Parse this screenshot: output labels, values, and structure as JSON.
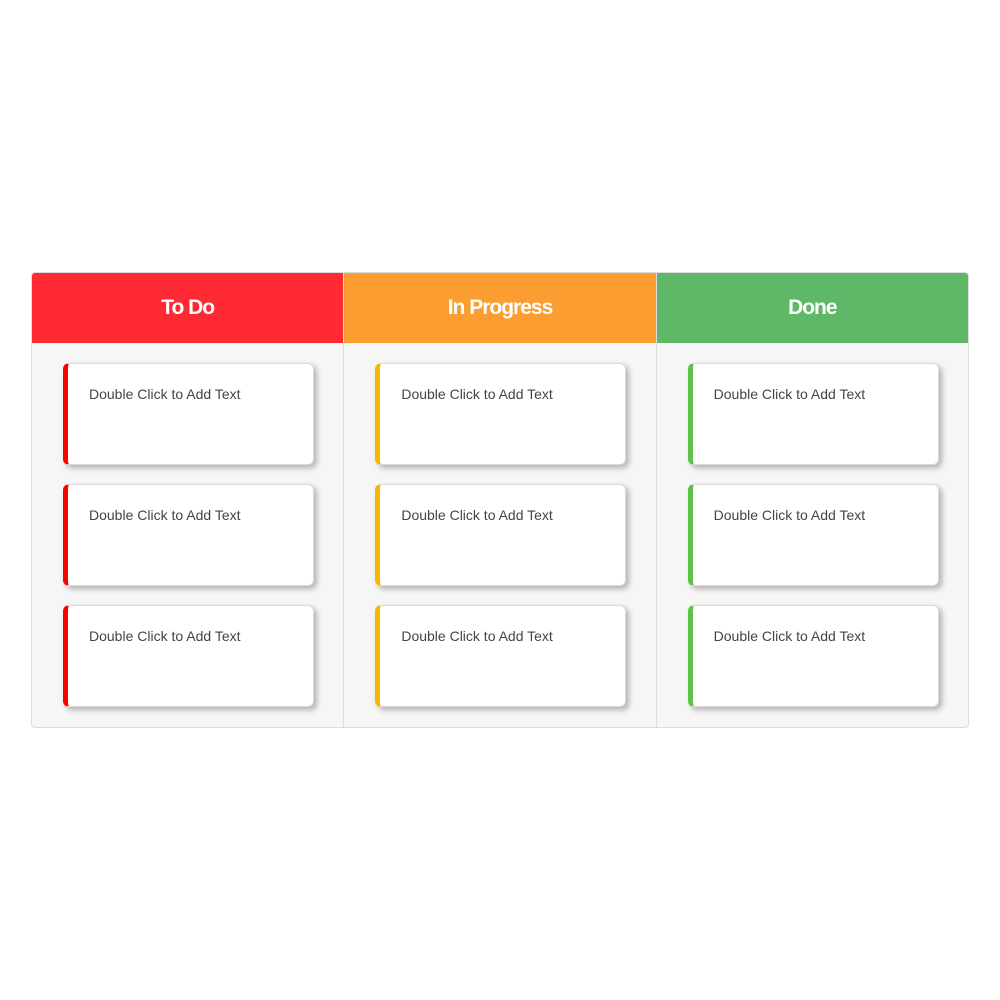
{
  "columns": [
    {
      "title": "To Do",
      "header_color": "#ff2934",
      "accent_color": "#ff0000",
      "cards": [
        "Double Click to Add Text",
        "Double Click to Add Text",
        "Double Click to Add Text"
      ]
    },
    {
      "title": "In Progress",
      "header_color": "#fb9d30",
      "accent_color": "#f5b800",
      "cards": [
        "Double Click to Add Text",
        "Double Click to Add Text",
        "Double Click to Add Text"
      ]
    },
    {
      "title": "Done",
      "header_color": "#5fb868",
      "accent_color": "#5ec14a",
      "cards": [
        "Double Click to Add Text",
        "Double Click to Add Text",
        "Double Click to Add Text"
      ]
    }
  ]
}
